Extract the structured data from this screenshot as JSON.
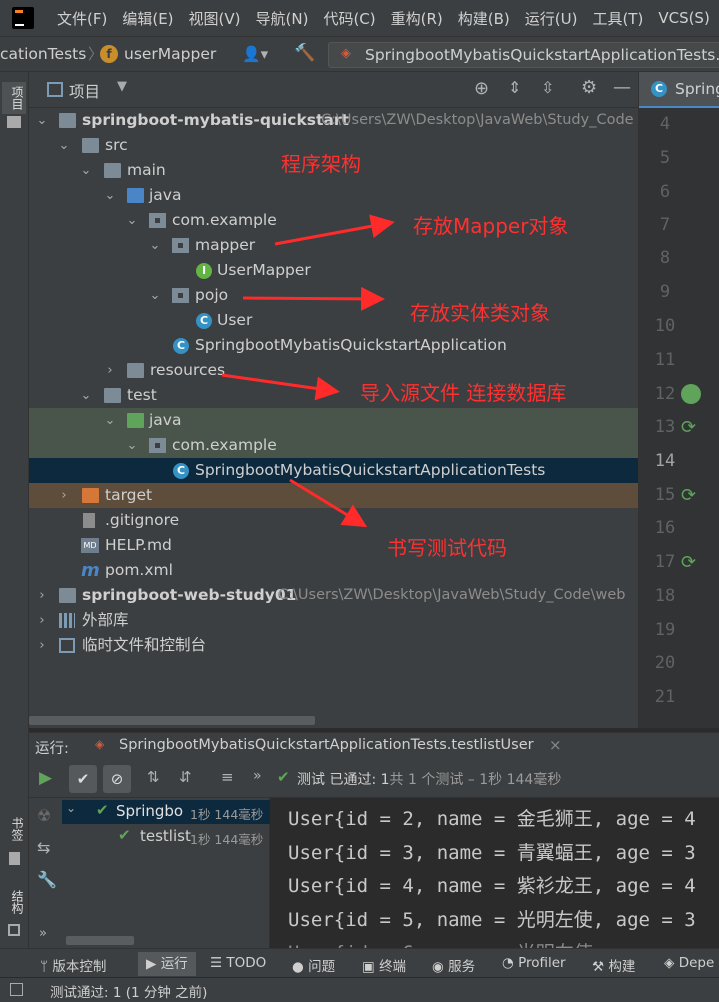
{
  "menu": [
    "文件(F)",
    "编辑(E)",
    "视图(V)",
    "导航(N)",
    "代码(C)",
    "重构(R)",
    "构建(B)",
    "运行(U)",
    "工具(T)",
    "VCS(S)",
    "窗"
  ],
  "nav": {
    "crumb1": "cationTests",
    "crumb2": "userMapper",
    "run_config": "SpringbootMybatisQuickstartApplicationTests.te"
  },
  "left_tabs": {
    "project": "项目",
    "bookmarks": "书签",
    "structure": "结构"
  },
  "project_panel": {
    "title": "项目"
  },
  "tree": [
    {
      "label": "springboot-mybatis-quickstart",
      "path": "C:\\Users\\ZW\\Desktop\\JavaWeb\\Study_Code"
    },
    {
      "label": "src"
    },
    {
      "label": "main"
    },
    {
      "label": "java"
    },
    {
      "label": "com.example"
    },
    {
      "label": "mapper"
    },
    {
      "label": "UserMapper",
      "badge": "I"
    },
    {
      "label": "pojo"
    },
    {
      "label": "User",
      "badge": "C"
    },
    {
      "label": "SpringbootMybatisQuickstartApplication"
    },
    {
      "label": "resources"
    },
    {
      "label": "test"
    },
    {
      "label": "java"
    },
    {
      "label": "com.example"
    },
    {
      "label": "SpringbootMybatisQuickstartApplicationTests"
    },
    {
      "label": "target"
    },
    {
      "label": ".gitignore"
    },
    {
      "label": "HELP.md",
      "badge": "MD"
    },
    {
      "label": "pom.xml",
      "badge": "m"
    },
    {
      "label": "springboot-web-study01",
      "path": "C:\\Users\\ZW\\Desktop\\JavaWeb\\Study_Code\\web"
    },
    {
      "label": "外部库"
    },
    {
      "label": "临时文件和控制台"
    }
  ],
  "annotations": {
    "arch": "程序架构",
    "mapper": "存放Mapper对象",
    "pojo": "存放实体类对象",
    "resources": "导入源文件 连接数据库",
    "test": "书写测试代码"
  },
  "editor": {
    "tab": "Spring",
    "lines": [
      "4",
      "5",
      "6",
      "7",
      "8",
      "9",
      "10",
      "11",
      "12",
      "13",
      "14",
      "15",
      "16",
      "17",
      "18",
      "19",
      "20",
      "21"
    ]
  },
  "run": {
    "label": "运行:",
    "config": "SpringbootMybatisQuickstartApplicationTests.testlistUser",
    "status_prefix": "测试 已通过:",
    "status_count": "1",
    "status_rest": "共 1 个测试 – 1秒 144毫秒",
    "tree": [
      {
        "label": "Springbo",
        "time": "1秒 144毫秒"
      },
      {
        "label": "testlist",
        "time": "1秒 144毫秒"
      }
    ],
    "console": [
      "User{id = 2, name = 金毛狮王, age = 4",
      "User{id = 3, name = 青翼蝠王, age = 3",
      "User{id = 4, name = 紫衫龙王, age = 4",
      "User{id = 5, name = 光明左使, age = 3",
      "User{id = 6, name = 光明右使"
    ]
  },
  "bottom_tabs": [
    "版本控制",
    "运行",
    "TODO",
    "问题",
    "终端",
    "服务",
    "Profiler",
    "构建",
    "Depe"
  ],
  "status": "测试通过: 1 (1 分钟 之前)"
}
